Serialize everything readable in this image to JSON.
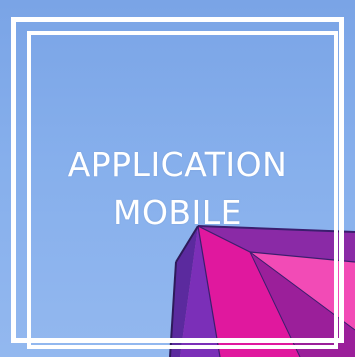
{
  "title": {
    "line1": "APPLICATION",
    "line2": "MOBILE"
  },
  "image": {
    "description_icon": "kite-sail-image"
  },
  "colors": {
    "sky": "#86afec",
    "frame": "#ffffff",
    "text": "#ffffff",
    "kite_magenta": "#e0189e",
    "kite_purple": "#6a2fa8",
    "kite_pink": "#f04fb0"
  }
}
